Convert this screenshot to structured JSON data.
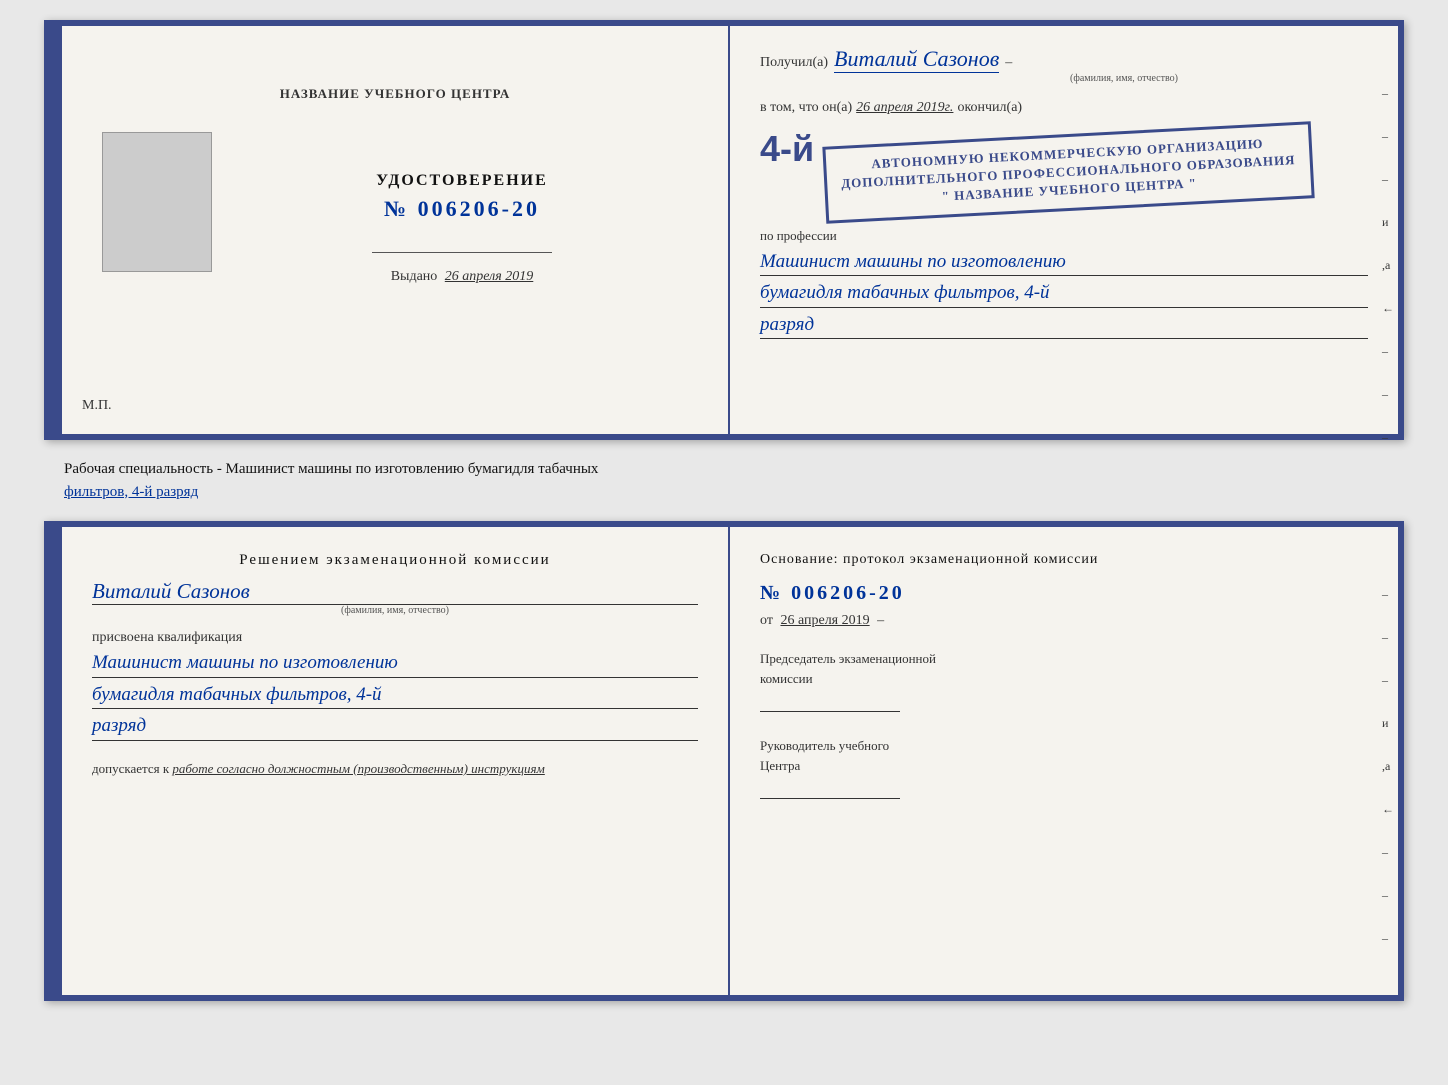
{
  "top_doc": {
    "left": {
      "center_title": "НАЗВАНИЕ УЧЕБНОГО ЦЕНТРА",
      "udost_label": "УДОСТОВЕРЕНИЕ",
      "udost_number": "№ 006206-20",
      "vydano_label": "Выдано",
      "vydano_date": "26 апреля 2019",
      "mp_label": "М.П."
    },
    "right": {
      "poluchil_prefix": "Получил(а)",
      "poluchil_name": "Виталий Сазонов",
      "poluchil_sublabel": "(фамилия, имя, отчество)",
      "dash": "–",
      "vtom_prefix": "в том, что он(а)",
      "vtom_date": "26 апреля 2019г.",
      "okonchil": "окончил(а)",
      "stamp_line1": "АВТОНОМНУЮ НЕКОММЕРЧЕСКУЮ ОРГАНИЗАЦИЮ",
      "stamp_line2": "ДОПОЛНИТЕЛЬНОГО ПРОФЕССИОНАЛЬНОГО ОБРАЗОВАНИЯ",
      "stamp_line3": "\" НАЗВАНИЕ УЧЕБНОГО ЦЕНТРА \"",
      "stamp_big": "4-й",
      "professii_label": "по профессии",
      "professii_name": "Машинист машины по изготовлению",
      "professii_name2": "бумагидля табачных фильтров, 4-й",
      "professii_name3": "разряд"
    },
    "edge_marks": [
      "-",
      "-",
      "-",
      "и",
      ",а",
      "←",
      "-",
      "-",
      "-"
    ]
  },
  "middle": {
    "text": "Рабочая специальность - Машинист машины по изготовлению бумагидля табачных",
    "text2_underline": "фильтров, 4-й разряд"
  },
  "bottom_doc": {
    "left": {
      "decision_title": "Решением  экзаменационной  комиссии",
      "name": "Виталий Сазонов",
      "name_sublabel": "(фамилия, имя, отчество)",
      "prisvoyena": "присвоена квалификация",
      "kvali1": "Машинист машины по изготовлению",
      "kvali2": "бумагидля табачных фильтров, 4-й",
      "kvali3": "разряд",
      "dopusk_prefix": "допускается к",
      "dopusk_text": "работе согласно должностным (производственным) инструкциям"
    },
    "right": {
      "osnovanie": "Основание: протокол экзаменационной  комиссии",
      "number": "№  006206-20",
      "ot_prefix": "от",
      "ot_date": "26 апреля 2019",
      "predsedatel1": "Председатель экзаменационной",
      "predsedatel2": "комиссии",
      "rukovoditel1": "Руководитель учебного",
      "rukovoditel2": "Центра"
    },
    "edge_marks": [
      "-",
      "-",
      "-",
      "и",
      ",а",
      "←",
      "-",
      "-",
      "-"
    ]
  }
}
